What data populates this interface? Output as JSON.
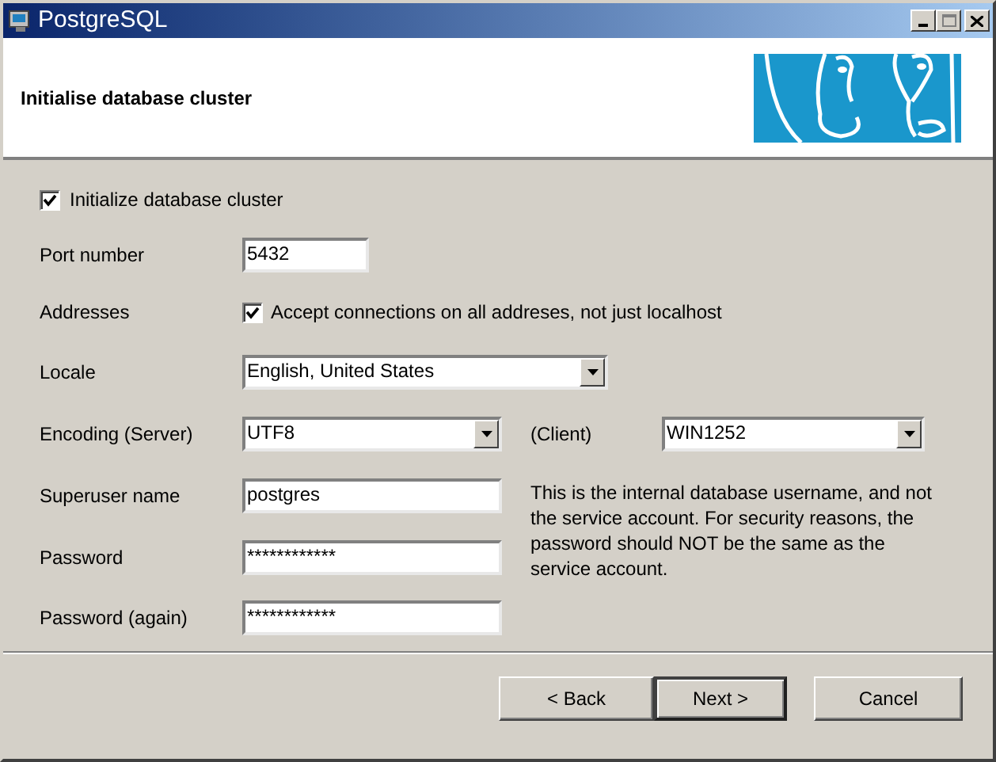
{
  "window": {
    "title": "PostgreSQL"
  },
  "header": {
    "title": "Initialise database cluster"
  },
  "rows": [
    {
      "kind": "checkbox",
      "label": "Initialize database cluster",
      "checked": true
    },
    {
      "kind": "text",
      "label": "Port number",
      "value": "5432"
    },
    {
      "kind": "labeled_checkbox",
      "label": "Addresses",
      "option": "Accept connections on all addreses, not just localhost",
      "checked": true
    },
    {
      "kind": "dropdown",
      "label": "Locale",
      "value": "English, United States"
    },
    {
      "kind": "dropdown_pair",
      "label": "Encoding (Server)",
      "value": "UTF8",
      "second_label": "(Client)",
      "second_value": "WIN1252"
    },
    {
      "kind": "text",
      "label": "Superuser name",
      "value": "postgres"
    },
    {
      "kind": "text",
      "label": "Password",
      "value": "************"
    },
    {
      "kind": "text",
      "label": "Password (again)",
      "value": "************"
    }
  ],
  "note": "This is the internal database username, and not the service account. For security reasons, the password should NOT be the same as the service account.",
  "buttons": [
    {
      "label": "< Back",
      "default": false
    },
    {
      "label": "Next >",
      "default": true
    },
    {
      "label": "Cancel",
      "default": false
    }
  ]
}
